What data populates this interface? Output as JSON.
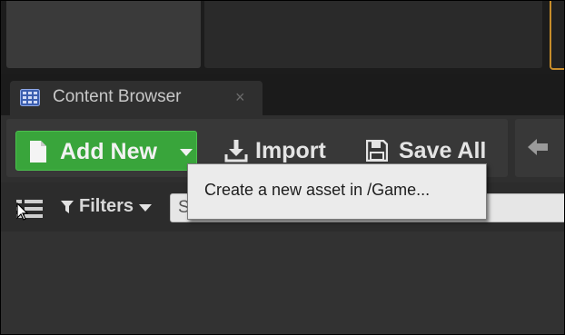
{
  "tab": {
    "title": "Content Browser",
    "close_glyph": "×",
    "icon": "content-browser-icon"
  },
  "toolbar": {
    "add_new_label": "Add New",
    "import_label": "Import",
    "save_all_label": "Save All",
    "add_new_icon": "document-icon",
    "import_icon": "download-icon",
    "save_all_icon": "save-icon",
    "nav_back_icon": "arrow-left-icon"
  },
  "filter_bar": {
    "filters_label": "Filters",
    "search_value": "S",
    "view_toggle_icon": "view-options-icon"
  },
  "tooltip": {
    "text": "Create a new asset in /Game..."
  },
  "colors": {
    "accent_green": "#39a53b",
    "highlight_orange": "#c78d2b",
    "tooltip_bg": "#ebebeb"
  }
}
